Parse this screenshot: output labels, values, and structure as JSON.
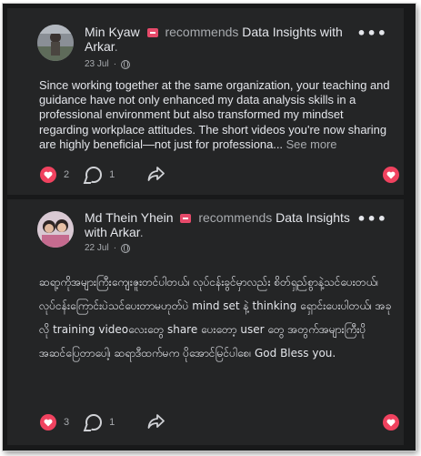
{
  "posts": [
    {
      "author": "Min Kyaw",
      "recommends_label": "recommends",
      "page": "Data Insights with Arkar",
      "date": "23 Jul",
      "separator": "·",
      "body": "Since working together at the same organization, your teaching and guidance have not only enhanced my data analysis skills in a professional environment but also transformed my mindset regarding workplace attitudes. The short videos you're now sharing are highly beneficial—not just for professiona...",
      "see_more": "See more",
      "reaction_count": "2",
      "comment_count": "1",
      "icons": [
        "heart-icon",
        "comment-icon",
        "share-icon",
        "more-icon",
        "globe-icon"
      ]
    },
    {
      "author": "Md Thein Yhein",
      "recommends_label": "recommends",
      "page": "Data Insights with Arkar",
      "date": "22 Jul",
      "separator": "·",
      "body": "ဆရာ့ကိုအများကြီးကျေးဇူးတင်ပါတယ်၊ လုပ်ငန်းခွင်မှာလည်း စိတ်ရှည်စွာနဲ့သင်ပေးတယ်၊ လုပ်ငန်းကြောင်းပဲသင်ပေးတာမဟုတ်ပဲ mind set နဲ့ thinking ရှောင်းပေးပါတယ်၊ အခုလို training videoလေးတွေ share ပေးတော့ user တွေ အတွက်အများကြီးပိုအဆင်ပြေတာပေါ့၊ ဆရာဒီထက်မက ပိုအောင်မြင်ပါစေ၊ God Bless you.",
      "reaction_count": "3",
      "comment_count": "1",
      "icons": [
        "heart-icon",
        "comment-icon",
        "share-icon",
        "more-icon",
        "globe-icon"
      ]
    }
  ],
  "colors": {
    "background": "#18191a",
    "card": "#242526",
    "text": "#e4e6eb",
    "muted": "#a8abaf",
    "accent": "#f0425f"
  }
}
